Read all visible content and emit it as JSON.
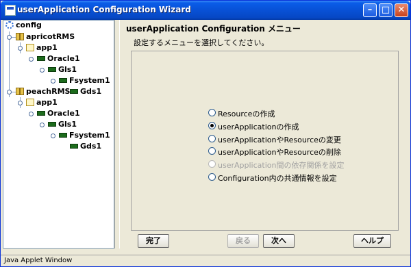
{
  "window": {
    "title": "userApplication Configuration Wizard"
  },
  "tree": {
    "rows": [
      {
        "label": "config"
      },
      {
        "label": "apricotRMS"
      },
      {
        "label": "app1"
      },
      {
        "label": "Oracle1"
      },
      {
        "label": "Gls1"
      },
      {
        "label": "Fsystem1"
      },
      {
        "label": "Gds1"
      },
      {
        "label": "peachRMS"
      },
      {
        "label": "app1"
      },
      {
        "label": "Oracle1"
      },
      {
        "label": "Gls1"
      },
      {
        "label": "Fsystem1"
      },
      {
        "label": "Gds1"
      }
    ]
  },
  "main": {
    "heading": "userApplication Configuration メニュー",
    "instruction": "設定するメニューを選択してください。",
    "options": [
      {
        "label": "Resourceの作成",
        "selected": false,
        "enabled": true
      },
      {
        "label": "userApplicationの作成",
        "selected": true,
        "enabled": true
      },
      {
        "label": "userApplicationやResourceの変更",
        "selected": false,
        "enabled": true
      },
      {
        "label": "userApplicationやResourceの削除",
        "selected": false,
        "enabled": true
      },
      {
        "label": "userApplication間の依存関係を設定",
        "selected": false,
        "enabled": false
      },
      {
        "label": "Configuration内の共通情報を設定",
        "selected": false,
        "enabled": true
      }
    ]
  },
  "buttons": {
    "finish": "完了",
    "back": "戻る",
    "next": "次へ",
    "help": "ヘルプ"
  },
  "status": {
    "text": "Java Applet Window"
  }
}
